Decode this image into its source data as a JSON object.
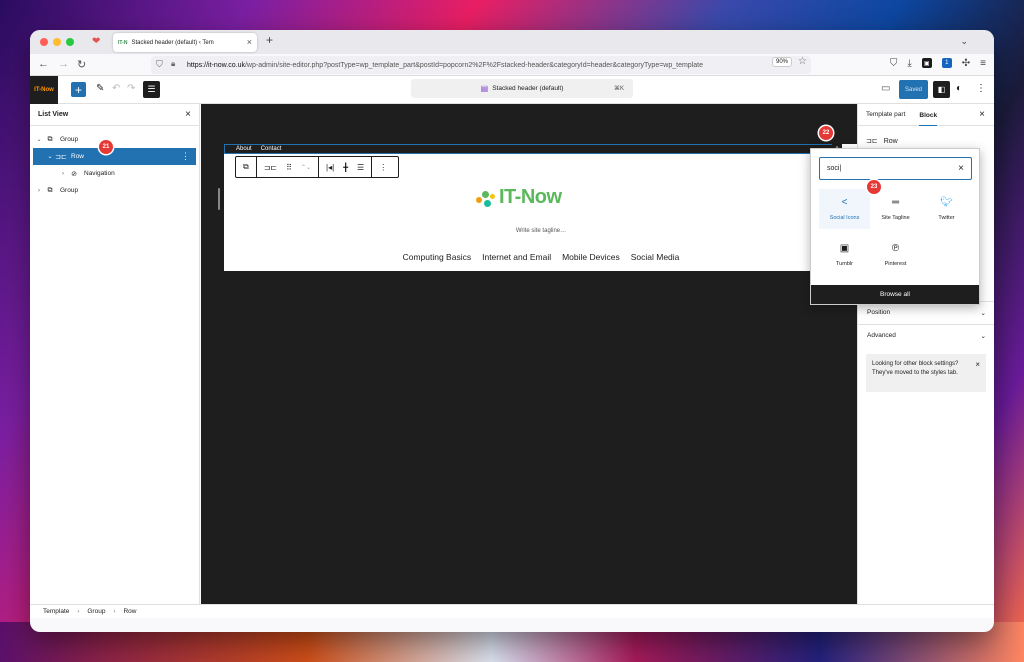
{
  "browser": {
    "tab_title": "Stacked header (default) ‹ Tem",
    "tab_favicon": "IT-N",
    "url_host": "https://it-now.co.uk",
    "url_path": "/wp-admin/site-editor.php?postType=wp_template_part&postId=popcorn2%2F%2Fstacked-header&categoryId=header&categoryType=wp_template",
    "zoom": "90%",
    "ext_count": "1"
  },
  "toolbar": {
    "site_logo_text": "IT-Now",
    "document_title": "Stacked header (default)",
    "shortcut": "⌘K",
    "saved_label": "Saved"
  },
  "list_view": {
    "title": "List View",
    "items": [
      {
        "label": "Group"
      },
      {
        "label": "Row"
      },
      {
        "label": "Navigation"
      },
      {
        "label": "Group"
      }
    ]
  },
  "annotations": {
    "step_21": "21",
    "step_22": "22",
    "step_23": "23"
  },
  "canvas": {
    "top_nav": [
      "About",
      "Contact"
    ],
    "site_title": "IT-Now",
    "tagline_placeholder": "Write site tagline…",
    "main_nav": [
      "Computing Basics",
      "Internet and Email",
      "Mobile Devices",
      "Social Media"
    ]
  },
  "inserter": {
    "search_value": "soci",
    "results": [
      {
        "label": "Social Icons",
        "icon": "share-icon"
      },
      {
        "label": "Site Tagline",
        "icon": "tagline-icon"
      },
      {
        "label": "Twitter",
        "icon": "twitter-icon"
      },
      {
        "label": "Tumblr",
        "icon": "tumblr-icon"
      },
      {
        "label": "Pinterest",
        "icon": "pinterest-icon"
      }
    ],
    "browse_all": "Browse all"
  },
  "sidebar": {
    "tabs": [
      "Template part",
      "Block"
    ],
    "block_name": "Row",
    "panels": [
      "Position",
      "Advanced"
    ],
    "notice": "Looking for other block settings? They've moved to the styles tab."
  },
  "breadcrumb": [
    "Template",
    "Group",
    "Row"
  ],
  "colors": {
    "accent": "#2271b1",
    "badge": "#e53935",
    "canvas_bg": "#1e1e1e",
    "logo_green": "#5bb85b",
    "logo_orange": "#f39c12"
  }
}
